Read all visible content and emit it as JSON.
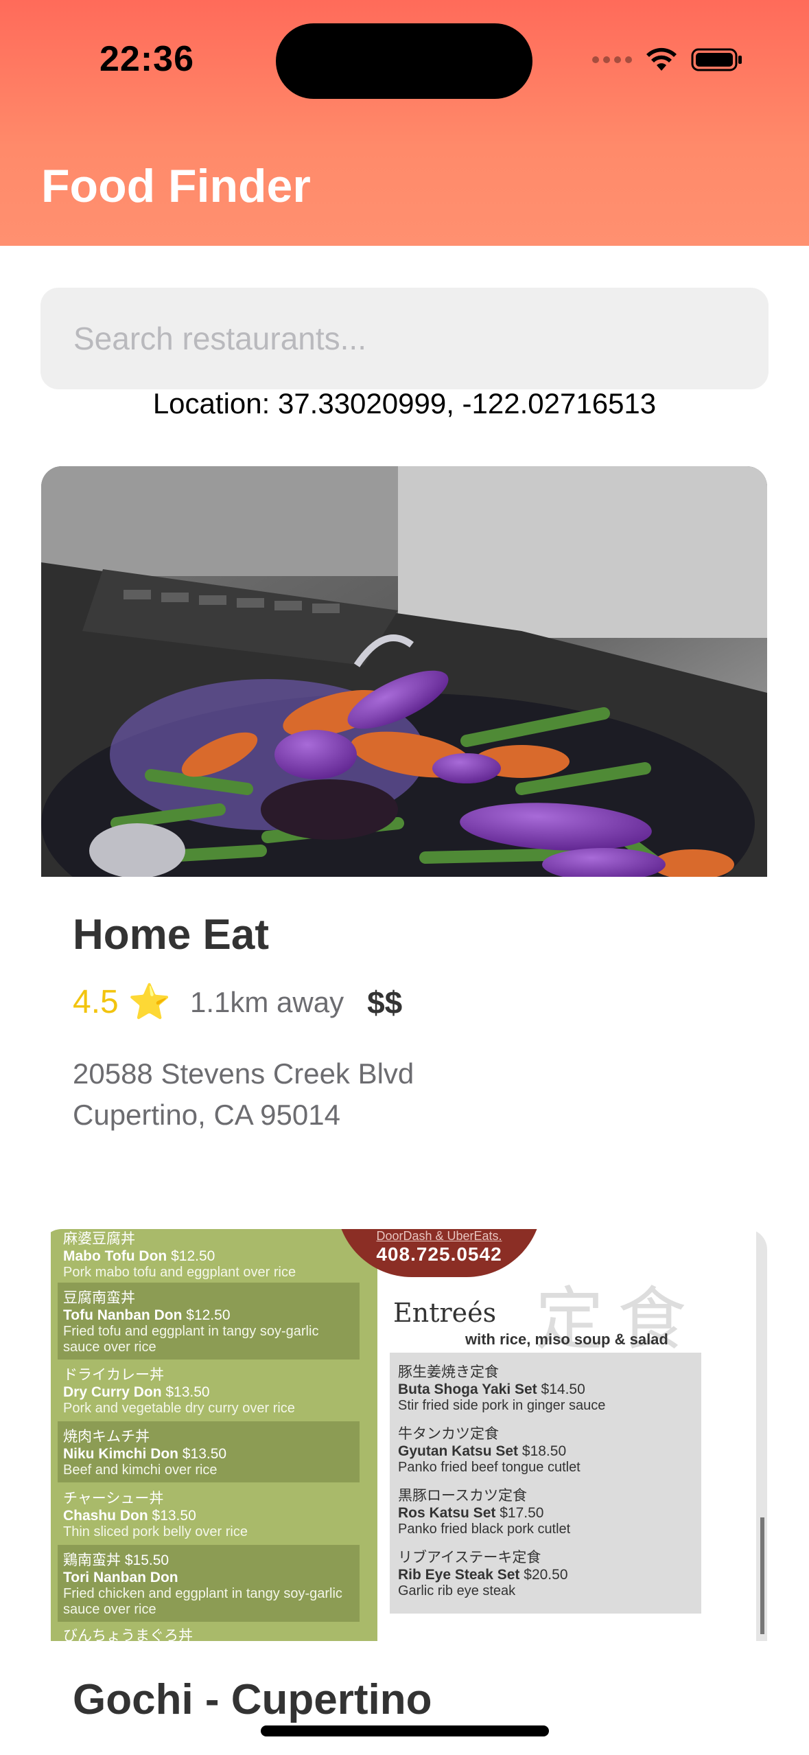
{
  "status_bar": {
    "time": "22:36"
  },
  "header": {
    "title": "Food Finder"
  },
  "search": {
    "placeholder": "Search restaurants...",
    "value": ""
  },
  "location": {
    "text": "Location: 37.33020999, -122.02716513"
  },
  "restaurants": [
    {
      "name": "Home Eat",
      "rating": "4.5",
      "rating_icon": "star-emoji",
      "distance": "1.1km away",
      "price": "$$",
      "address_line1": "20588 Stevens Creek Blvd",
      "address_line2": "Cupertino, CA 95014"
    },
    {
      "name": "Gochi - Cupertino",
      "menu_image": {
        "phone_caption": "DoorDash & UberEats.",
        "phone": "408.725.0542",
        "left_items": [
          {
            "jp": "麻婆豆腐丼",
            "name": "Mabo Tofu Don",
            "price": "$12.50",
            "desc": "Pork mabo tofu and eggplant over rice"
          },
          {
            "jp": "豆腐南蛮丼",
            "name": "Tofu Nanban Don",
            "price": "$12.50",
            "desc": "Fried tofu and eggplant in tangy soy-garlic sauce over rice"
          },
          {
            "jp": "ドライカレー丼",
            "name": "Dry Curry Don",
            "price": "$13.50",
            "desc": "Pork and vegetable dry curry over rice"
          },
          {
            "jp": "焼肉キムチ丼",
            "name": "Niku Kimchi Don",
            "price": "$13.50",
            "desc": "Beef and kimchi over rice"
          },
          {
            "jp": "チャーシュー丼",
            "name": "Chashu Don",
            "price": "$13.50",
            "desc": "Thin sliced pork belly over rice"
          },
          {
            "jp": "鶏南蛮丼 $15.50",
            "name": "Tori Nanban Don",
            "price": "",
            "desc": "Fried chicken and eggplant in tangy soy-garlic sauce over rice"
          }
        ],
        "left_footer": "びんちょうまぐろ丼",
        "entrees_title": "Entreés",
        "entrees_subtitle": "with rice, miso soup & salad",
        "entrees_kanji": "定食",
        "entrees": [
          {
            "jp": "豚生姜焼き定食",
            "name": "Buta Shoga Yaki Set",
            "price": "$14.50",
            "desc": "Stir fried side pork in ginger sauce"
          },
          {
            "jp": "牛タンカツ定食",
            "name": "Gyutan Katsu Set",
            "price": "$18.50",
            "desc": "Panko fried beef tongue cutlet"
          },
          {
            "jp": "黒豚ロースカツ定食",
            "name": "Ros Katsu Set",
            "price": "$17.50",
            "desc": "Panko fried black pork cutlet"
          },
          {
            "jp": "リブアイステーキ定食",
            "name": "Rib Eye Steak Set",
            "price": "$20.50",
            "desc": "Garlic rib eye steak"
          }
        ]
      }
    }
  ],
  "colors": {
    "header_gradient_top": "#ff6b5a",
    "header_gradient_bottom": "#ff9070",
    "rating": "#f2c40f",
    "search_bg": "#efefef"
  }
}
